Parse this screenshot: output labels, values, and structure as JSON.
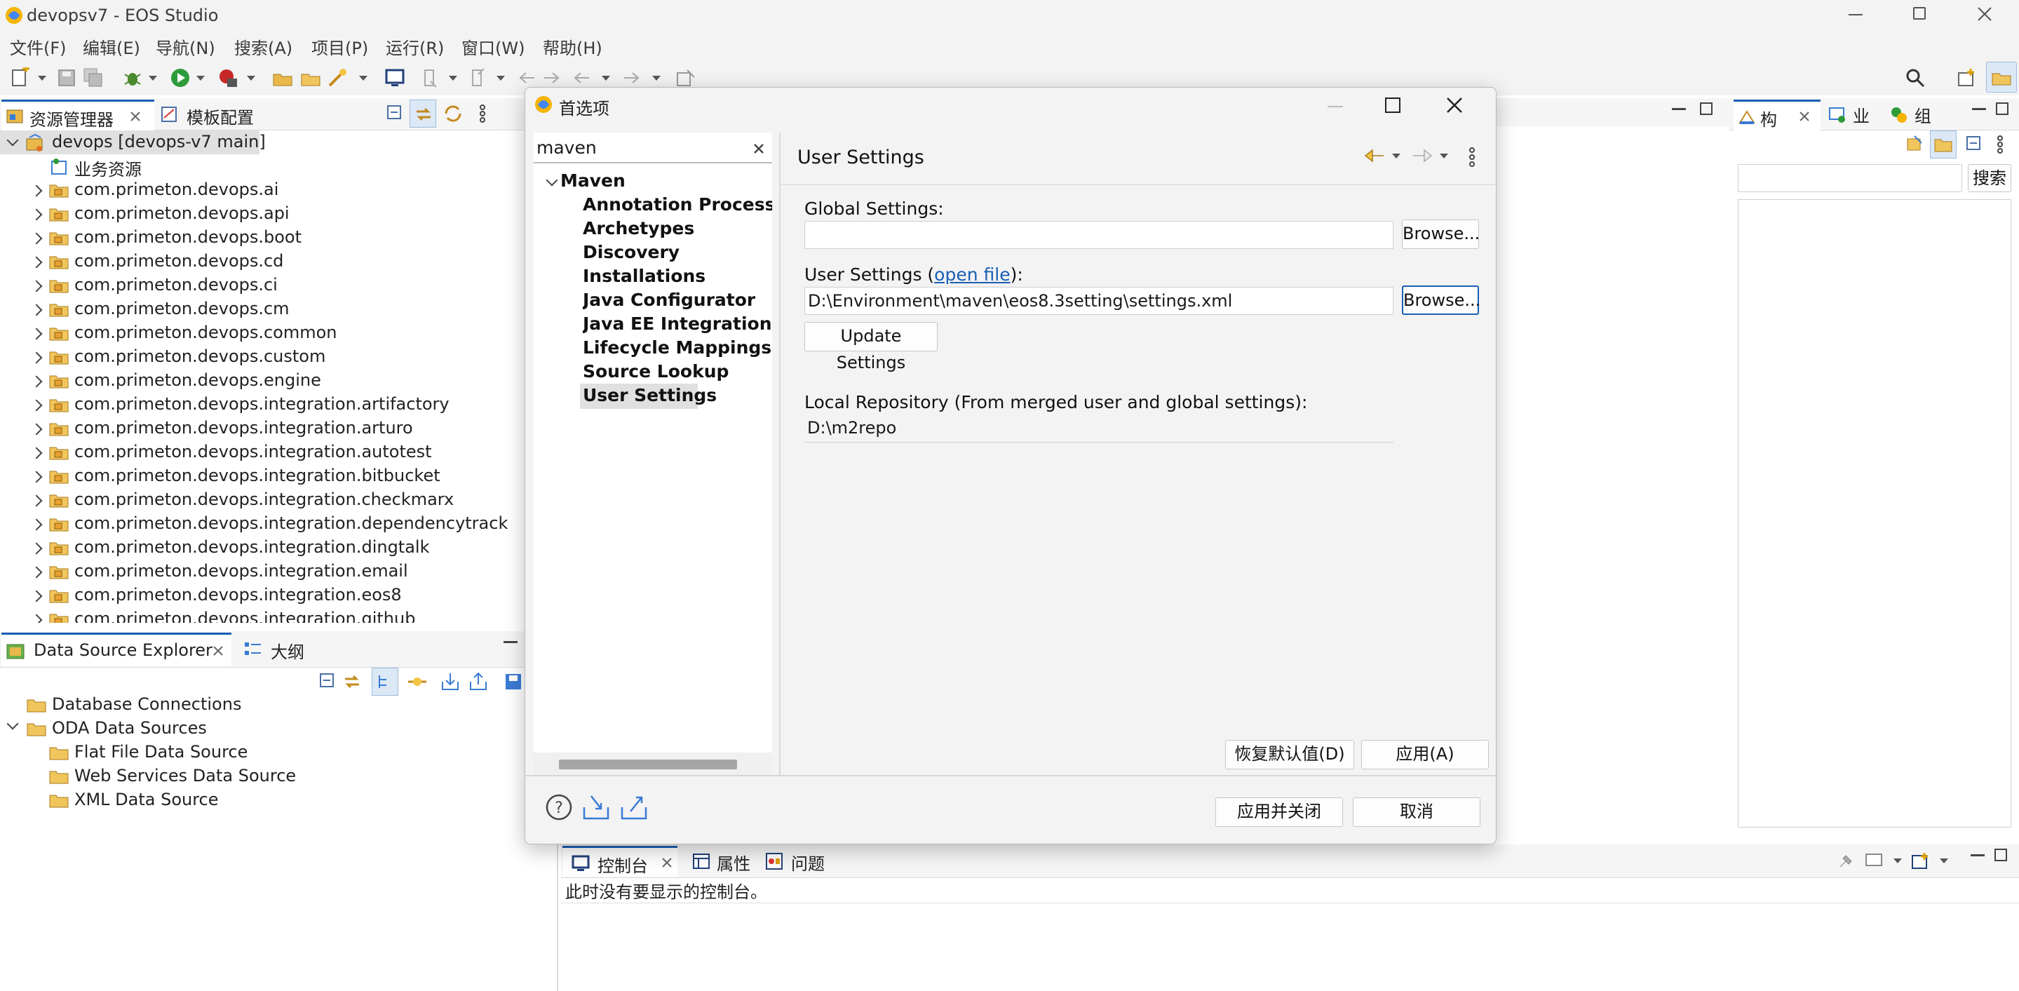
{
  "window": {
    "title": "devopsv7 - EOS Studio"
  },
  "menu": [
    "文件(F)",
    "编辑(E)",
    "导航(N)",
    "搜索(A)",
    "项目(P)",
    "运行(R)",
    "窗口(W)",
    "帮助(H)"
  ],
  "explorer": {
    "tabs": [
      "资源管理器",
      "模板配置"
    ],
    "root": "devops [devops-v7 main]",
    "business": "业务资源",
    "packages": [
      "com.primeton.devops.ai",
      "com.primeton.devops.api",
      "com.primeton.devops.boot",
      "com.primeton.devops.cd",
      "com.primeton.devops.ci",
      "com.primeton.devops.cm",
      "com.primeton.devops.common",
      "com.primeton.devops.custom",
      "com.primeton.devops.engine",
      "com.primeton.devops.integration.artifactory",
      "com.primeton.devops.integration.arturo",
      "com.primeton.devops.integration.autotest",
      "com.primeton.devops.integration.bitbucket",
      "com.primeton.devops.integration.checkmarx",
      "com.primeton.devops.integration.dependencytrack",
      "com.primeton.devops.integration.dingtalk",
      "com.primeton.devops.integration.email",
      "com.primeton.devops.integration.eos8",
      "com.primeton.devops.integration.github"
    ]
  },
  "datasource": {
    "tabs": [
      "Data Source Explorer",
      "大纲"
    ],
    "items": [
      "Database Connections",
      "ODA Data Sources",
      "Flat File Data Source",
      "Web Services Data Source",
      "XML Data Source"
    ]
  },
  "right_panel": {
    "tabs": [
      "构",
      "业",
      "组"
    ],
    "search_button": "搜索"
  },
  "console": {
    "tabs": [
      "控制台",
      "属性",
      "问题"
    ],
    "message": "此时没有要显示的控制台。"
  },
  "dialog": {
    "title": "首选项",
    "filter_value": "maven",
    "tree_root": "Maven",
    "tree_items": [
      "Annotation Processing",
      "Archetypes",
      "Discovery",
      "Installations",
      "Java Configurator",
      "Java EE Integration",
      "Lifecycle Mappings",
      "Source Lookup",
      "User Settings"
    ],
    "selected_item": "User Settings",
    "page_title": "User Settings",
    "global_settings_label": "Global Settings:",
    "global_settings_value": "",
    "user_settings_label_prefix": "User Settings (",
    "user_settings_link": "open file",
    "user_settings_label_suffix": "):",
    "user_settings_value": "D:\\Environment\\maven\\eos8.3setting\\settings.xml",
    "browse_label": "Browse...",
    "update_settings_label": "Update Settings",
    "local_repo_label": "Local Repository (From merged user and global settings):",
    "local_repo_value": "D:\\m2repo",
    "restore_defaults_label": "恢复默认值(D)",
    "apply_label": "应用(A)",
    "apply_close_label": "应用并关闭",
    "cancel_label": "取消"
  },
  "colors": {
    "accent": "#1a5fb4",
    "selection": "#e0e0e0",
    "chrome": "#f3f3f3"
  }
}
